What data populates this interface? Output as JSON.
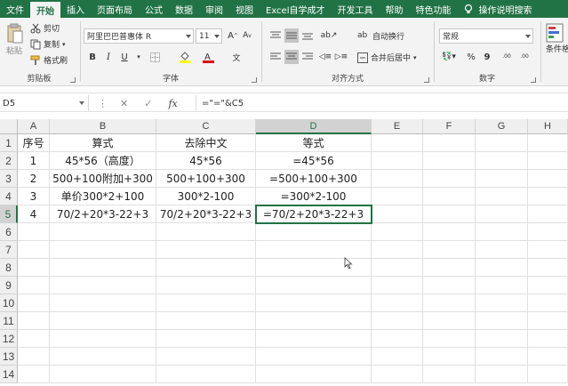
{
  "ribbon_tabs": [
    "文件",
    "开始",
    "插入",
    "页面布局",
    "公式",
    "数据",
    "审阅",
    "视图",
    "Excel自学成才",
    "开发工具",
    "帮助",
    "特色功能"
  ],
  "help_search": "操作说明搜索",
  "clipboard": {
    "paste_label": "粘贴",
    "cut_label": "剪切",
    "copy_label": "复制",
    "format_painter_label": "格式刷",
    "group_label": "剪贴板"
  },
  "font": {
    "font_name": "阿里巴巴普惠体 R",
    "font_size": "11",
    "grow_label": "A",
    "shrink_label": "A",
    "bold": "B",
    "italic": "I",
    "underline": "U",
    "group_label": "字体"
  },
  "alignment": {
    "wrap_text_label": "自动换行",
    "merge_center_label": "合并后居中",
    "group_label": "对齐方式"
  },
  "number": {
    "format": "常规",
    "percent": "%",
    "comma": "9",
    "inc_decimal": ".00",
    "dec_decimal": ".00",
    "group_label": "数字"
  },
  "styles": {
    "conditional_label": "条件格"
  },
  "formula_bar": {
    "name_box": "D5",
    "fx": "fx",
    "formula": "=\"=\"&C5"
  },
  "columns": [
    "A",
    "B",
    "C",
    "D",
    "E",
    "F",
    "G",
    "H"
  ],
  "rows": [
    "1",
    "2",
    "3",
    "4",
    "5",
    "6",
    "7",
    "8",
    "9",
    "10",
    "11",
    "12",
    "13",
    "14"
  ],
  "table": [
    [
      "序号",
      "算式",
      "去除中文",
      "等式"
    ],
    [
      "1",
      "45*56（高度）",
      "45*56",
      "=45*56"
    ],
    [
      "2",
      "500+100附加+300",
      "500+100+300",
      "=500+100+300"
    ],
    [
      "3",
      "单价300*2+100",
      "300*2-100",
      "=300*2-100"
    ],
    [
      "4",
      "70/2+20*3-22+3",
      "70/2+20*3-22+3",
      "=70/2+20*3-22+3"
    ]
  ],
  "colors": {
    "accent": "#217346",
    "ribbon_bg": "#f3f3f3"
  }
}
